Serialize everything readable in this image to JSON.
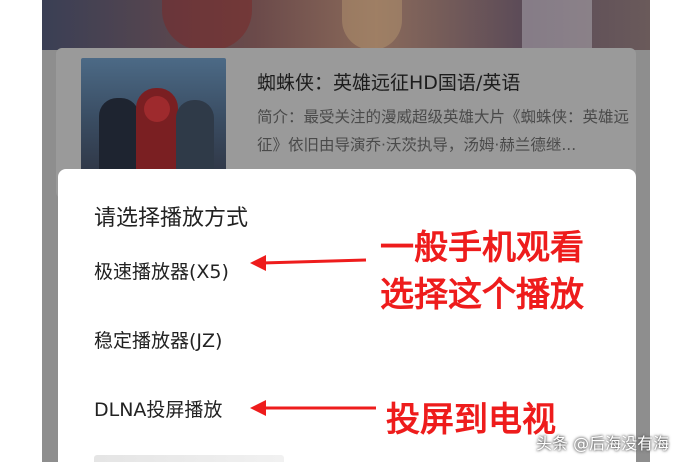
{
  "movie": {
    "title": "蜘蛛侠：英雄远征HD国语/英语",
    "description": "简介：最受关注的漫威超级英雄大片《蜘蛛侠：英雄远征》依旧由导演乔·沃茨执导，汤姆·赫兰德继..."
  },
  "dialog": {
    "title": "请选择播放方式",
    "options": [
      {
        "label": "极速播放器(X5)"
      },
      {
        "label": "稳定播放器(JZ)"
      },
      {
        "label": "DLNA投屏播放"
      }
    ]
  },
  "annotations": {
    "line1": "一般手机观看",
    "line2": "选择这个播放",
    "line3": "投屏到电视",
    "color": "#ee1c1c"
  },
  "watermark": "头条 @后海没有海"
}
